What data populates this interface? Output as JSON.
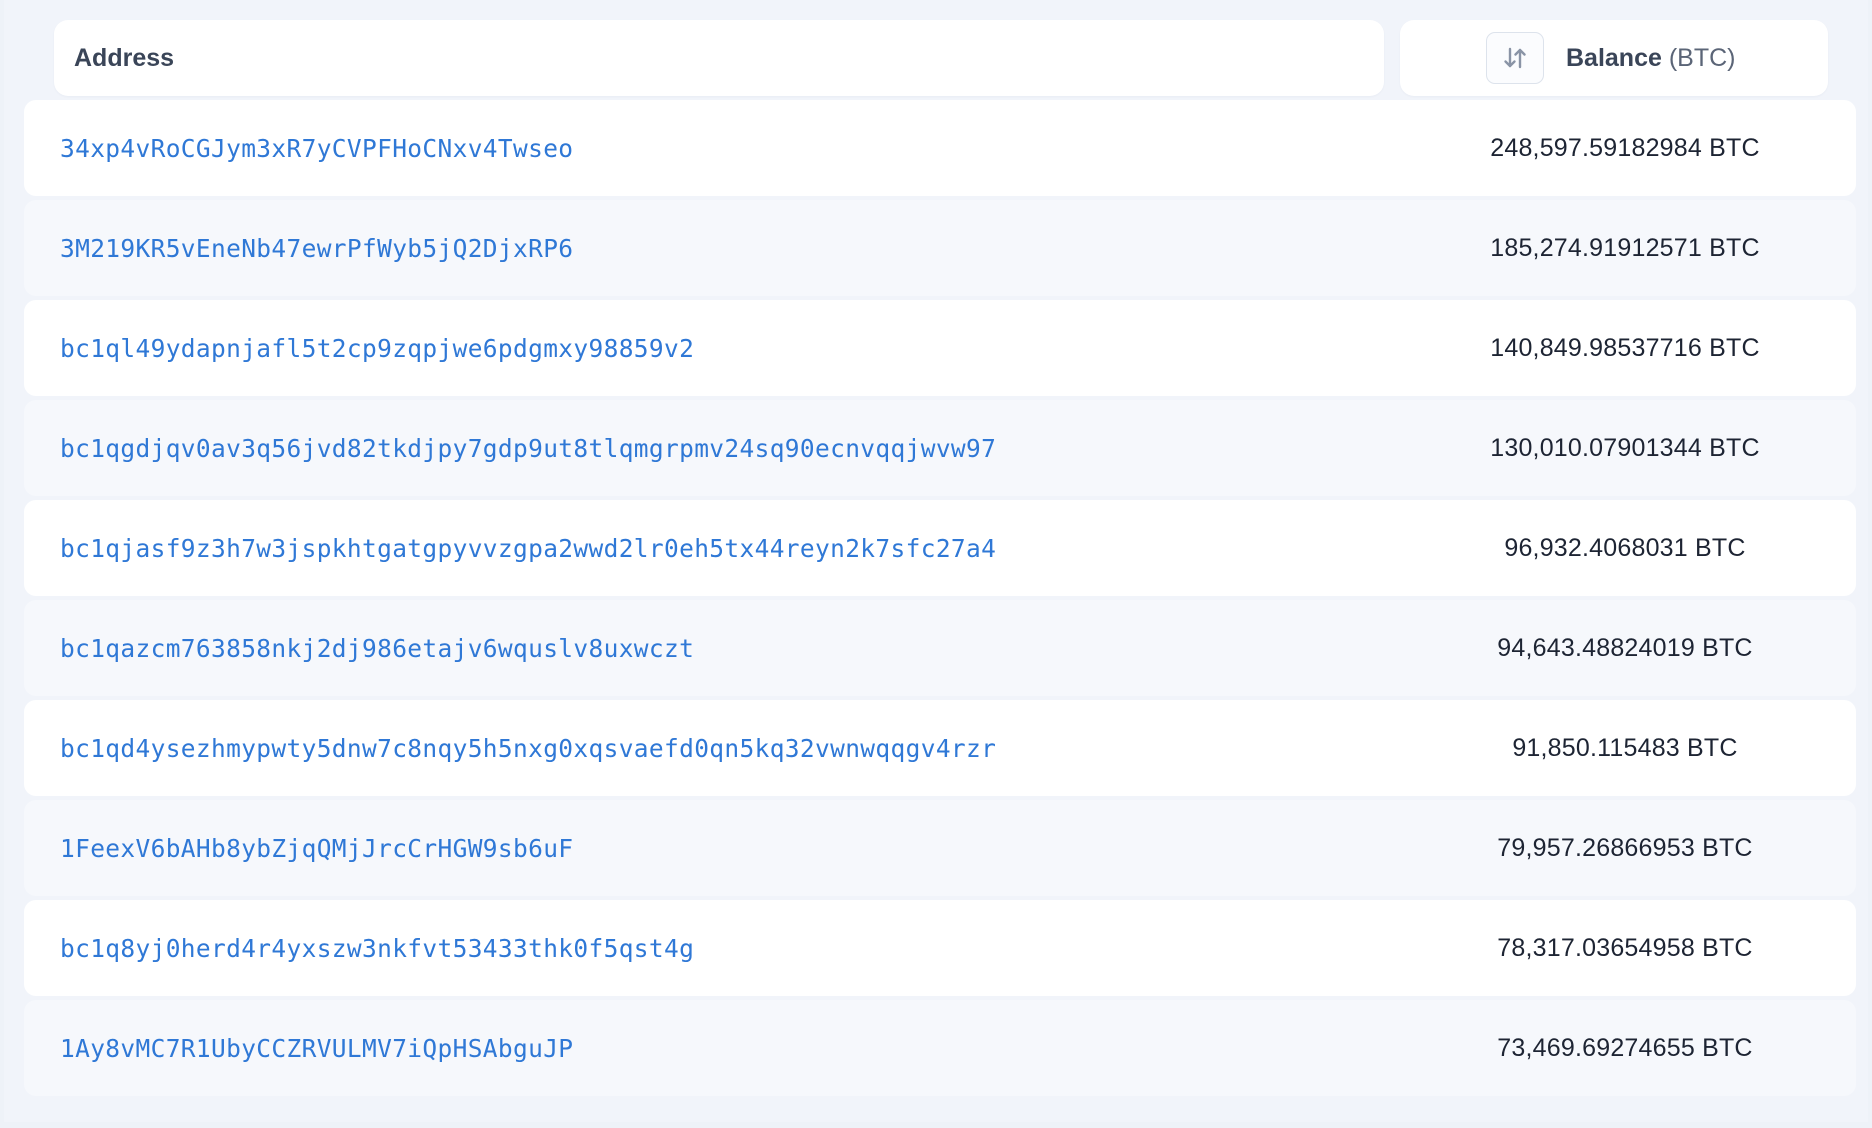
{
  "table": {
    "header": {
      "address_label": "Address",
      "balance_label": "Balance",
      "balance_unit": "(BTC)",
      "sort_icon": "sort-arrows-icon"
    },
    "rows": [
      {
        "address": "34xp4vRoCGJym3xR7yCVPFHoCNxv4Twseo",
        "balance": "248,597.59182984 BTC"
      },
      {
        "address": "3M219KR5vEneNb47ewrPfWyb5jQ2DjxRP6",
        "balance": "185,274.91912571 BTC"
      },
      {
        "address": "bc1ql49ydapnjafl5t2cp9zqpjwe6pdgmxy98859v2",
        "balance": "140,849.98537716 BTC"
      },
      {
        "address": "bc1qgdjqv0av3q56jvd82tkdjpy7gdp9ut8tlqmgrpmv24sq90ecnvqqjwvw97",
        "balance": "130,010.07901344 BTC"
      },
      {
        "address": "bc1qjasf9z3h7w3jspkhtgatgpyvvzgpa2wwd2lr0eh5tx44reyn2k7sfc27a4",
        "balance": "96,932.4068031 BTC"
      },
      {
        "address": "bc1qazcm763858nkj2dj986etajv6wquslv8uxwczt",
        "balance": "94,643.48824019 BTC"
      },
      {
        "address": "bc1qd4ysezhmypwty5dnw7c8nqy5h5nxg0xqsvaefd0qn5kq32vwnwqqgv4rzr",
        "balance": "91,850.115483 BTC"
      },
      {
        "address": "1FeexV6bAHb8ybZjqQMjJrcCrHGW9sb6uF",
        "balance": "79,957.26866953 BTC"
      },
      {
        "address": "bc1q8yj0herd4r4yxszw3nkfvt53433thk0f5qst4g",
        "balance": "78,317.03654958 BTC"
      },
      {
        "address": "1Ay8vMC7R1UbyCCZRVULMV7iQpHSAbguJP",
        "balance": "73,469.69274655 BTC"
      }
    ]
  },
  "colors": {
    "link": "#2f78d6",
    "text": "#1d2433",
    "header_text": "#3a4558",
    "background": "#f1f4fa"
  }
}
